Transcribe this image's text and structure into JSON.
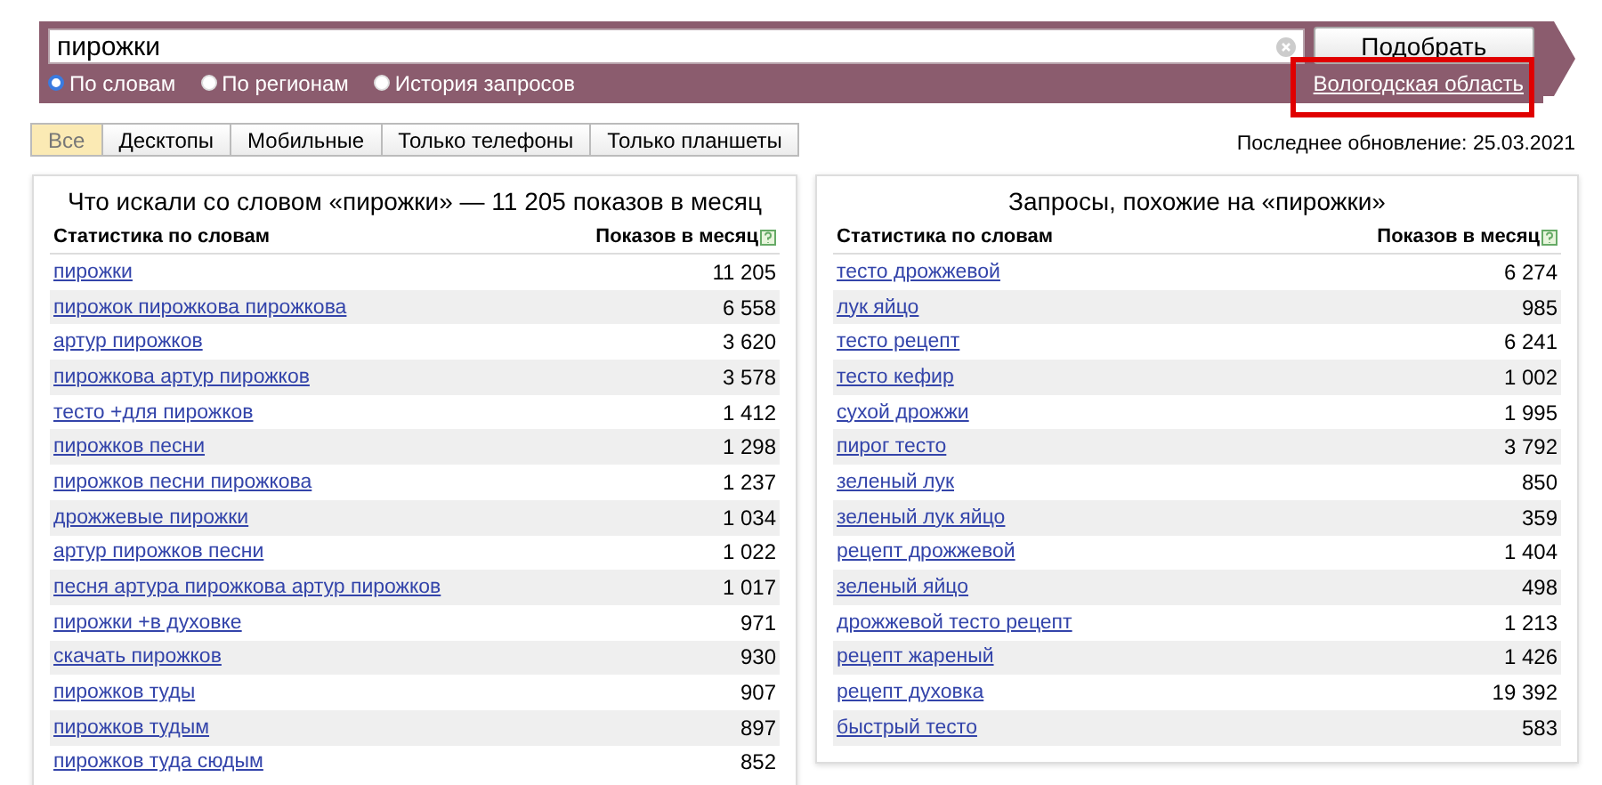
{
  "search": {
    "value": "пирожки",
    "button": "Подобрать"
  },
  "modes": [
    {
      "label": "По словам",
      "selected": true
    },
    {
      "label": "По регионам",
      "selected": false
    },
    {
      "label": "История запросов",
      "selected": false
    }
  ],
  "region": {
    "label": "Вологодская область",
    "highlighted": true
  },
  "tabs": [
    {
      "label": "Все",
      "selected": true
    },
    {
      "label": "Десктопы",
      "selected": false
    },
    {
      "label": "Мобильные",
      "selected": false
    },
    {
      "label": "Только телефоны",
      "selected": false
    },
    {
      "label": "Только планшеты",
      "selected": false
    }
  ],
  "last_update": "Последнее обновление: 25.03.2021",
  "panels": [
    {
      "title": "Что искали со словом «пирожки» — 11 205 показов в месяц",
      "columns": [
        "Статистика по словам",
        "Показов в месяц"
      ],
      "rows": [
        {
          "phrase": "пирожки",
          "count": "11 205"
        },
        {
          "phrase": "пирожок пирожкова пирожкова",
          "count": "6 558"
        },
        {
          "phrase": "артур пирожков",
          "count": "3 620"
        },
        {
          "phrase": "пирожкова артур пирожков",
          "count": "3 578"
        },
        {
          "phrase": "тесто +для пирожков",
          "count": "1 412"
        },
        {
          "phrase": "пирожков песни",
          "count": "1 298"
        },
        {
          "phrase": "пирожков песни пирожкова",
          "count": "1 237"
        },
        {
          "phrase": "дрожжевые пирожки",
          "count": "1 034"
        },
        {
          "phrase": "артур пирожков песни",
          "count": "1 022"
        },
        {
          "phrase": "песня артура пирожкова артур пирожков",
          "count": "1 017"
        },
        {
          "phrase": "пирожки +в духовке",
          "count": "971"
        },
        {
          "phrase": "скачать пирожков",
          "count": "930"
        },
        {
          "phrase": "пирожков туды",
          "count": "907"
        },
        {
          "phrase": "пирожков тудым",
          "count": "897"
        },
        {
          "phrase": "пирожков туда сюдым",
          "count": "852"
        }
      ]
    },
    {
      "title": "Запросы, похожие на «пирожки»",
      "columns": [
        "Статистика по словам",
        "Показов в месяц"
      ],
      "rows": [
        {
          "phrase": "тесто дрожжевой",
          "count": "6 274"
        },
        {
          "phrase": "лук яйцо",
          "count": "985"
        },
        {
          "phrase": "тесто рецепт",
          "count": "6 241"
        },
        {
          "phrase": "тесто кефир",
          "count": "1 002"
        },
        {
          "phrase": "сухой дрожжи",
          "count": "1 995"
        },
        {
          "phrase": "пирог тесто",
          "count": "3 792"
        },
        {
          "phrase": "зеленый лук",
          "count": "850"
        },
        {
          "phrase": "зеленый лук яйцо",
          "count": "359"
        },
        {
          "phrase": "рецепт дрожжевой",
          "count": "1 404"
        },
        {
          "phrase": "зеленый яйцо",
          "count": "498"
        },
        {
          "phrase": "дрожжевой тесто рецепт",
          "count": "1 213"
        },
        {
          "phrase": "рецепт жареный",
          "count": "1 426"
        },
        {
          "phrase": "рецепт духовка",
          "count": "19 392"
        },
        {
          "phrase": "быстрый тесто",
          "count": "583"
        }
      ]
    }
  ]
}
